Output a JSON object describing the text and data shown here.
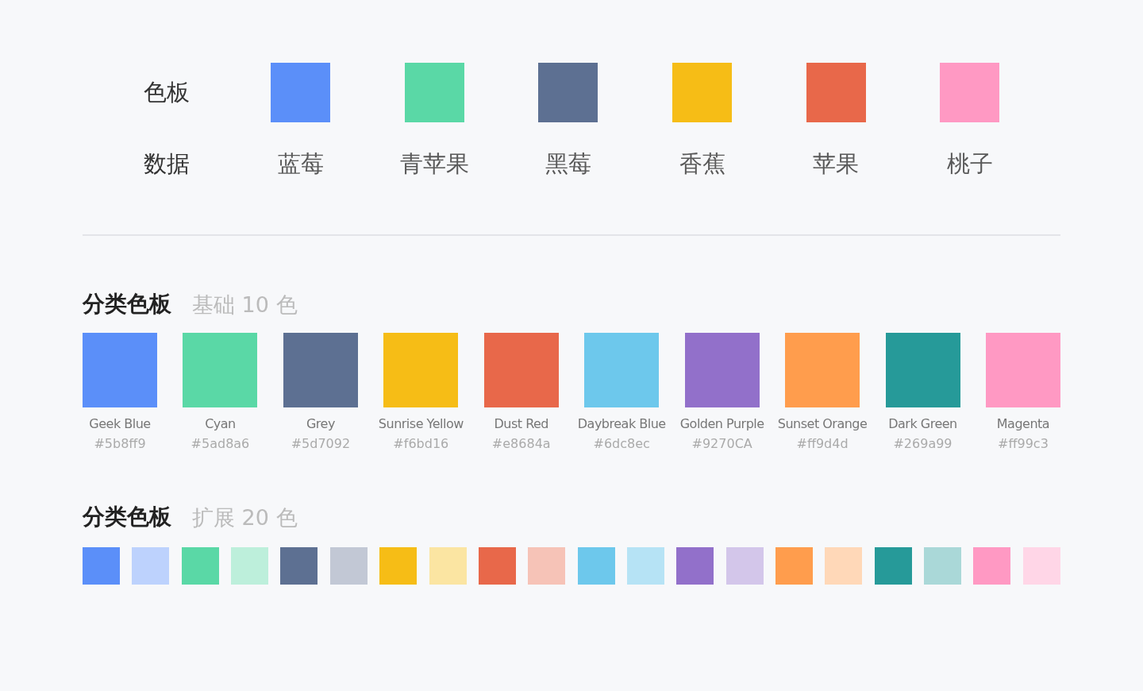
{
  "palette_demo": {
    "row_labels": [
      "色板",
      "数据"
    ],
    "swatches": [
      {
        "color": "#5b8ff9",
        "label": "蓝莓"
      },
      {
        "color": "#5ad8a6",
        "label": "青苹果"
      },
      {
        "color": "#5d7092",
        "label": "黑莓"
      },
      {
        "color": "#f6bd16",
        "label": "香蕉"
      },
      {
        "color": "#e8684a",
        "label": "苹果"
      },
      {
        "color": "#ff99c3",
        "label": "桃子"
      }
    ]
  },
  "basic_palette": {
    "title": "分类色板",
    "subtitle": "基础 10 色",
    "swatches": [
      {
        "color": "#5b8ff9",
        "name": "Geek Blue",
        "hex": "#5b8ff9"
      },
      {
        "color": "#5ad8a6",
        "name": "Cyan",
        "hex": "#5ad8a6"
      },
      {
        "color": "#5d7092",
        "name": "Grey",
        "hex": "#5d7092"
      },
      {
        "color": "#f6bd16",
        "name": "Sunrise Yellow",
        "hex": "#f6bd16"
      },
      {
        "color": "#e8684a",
        "name": "Dust Red",
        "hex": "#e8684a"
      },
      {
        "color": "#6dc8ec",
        "name": "Daybreak Blue",
        "hex": "#6dc8ec"
      },
      {
        "color": "#9270ca",
        "name": "Golden Purple",
        "hex": "#9270CA"
      },
      {
        "color": "#ff9d4d",
        "name": "Sunset Orange",
        "hex": "#ff9d4d"
      },
      {
        "color": "#269a99",
        "name": "Dark Green",
        "hex": "#269a99"
      },
      {
        "color": "#ff99c3",
        "name": "Magenta",
        "hex": "#ff99c3"
      }
    ]
  },
  "extended_palette": {
    "title": "分类色板",
    "subtitle": "扩展 20 色",
    "swatches": [
      {
        "color": "#5b8ff9"
      },
      {
        "color": "#bdd2fd"
      },
      {
        "color": "#5ad8a6"
      },
      {
        "color": "#bdefdb"
      },
      {
        "color": "#5d7092"
      },
      {
        "color": "#c2c8d5"
      },
      {
        "color": "#f6bd16"
      },
      {
        "color": "#fbe5a2"
      },
      {
        "color": "#e8684a"
      },
      {
        "color": "#f6c3b7"
      },
      {
        "color": "#6dc8ec"
      },
      {
        "color": "#b6e3f5"
      },
      {
        "color": "#9270ca"
      },
      {
        "color": "#d3c6ea"
      },
      {
        "color": "#ff9d4d"
      },
      {
        "color": "#ffd8b8"
      },
      {
        "color": "#269a99"
      },
      {
        "color": "#aad8d8"
      },
      {
        "color": "#ff99c3"
      },
      {
        "color": "#ffd6e7"
      }
    ]
  }
}
